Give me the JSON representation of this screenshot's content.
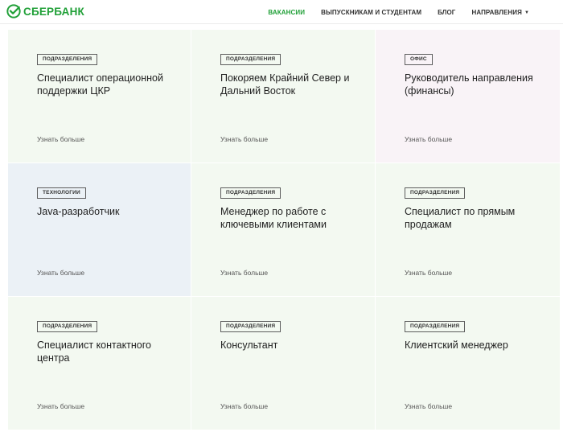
{
  "header": {
    "logo_text": "СБЕРБАНК",
    "nav": [
      {
        "label": "ВАКАНСИИ",
        "active": true
      },
      {
        "label": "ВЫПУСКНИКАМ И СТУДЕНТАМ",
        "active": false
      },
      {
        "label": "БЛОГ",
        "active": false
      },
      {
        "label": "НАПРАВЛЕНИЯ",
        "active": false,
        "dropdown": true
      }
    ]
  },
  "cards": [
    {
      "tag": "ПОДРАЗДЕЛЕНИЯ",
      "title": "Специалист операционной поддержки ЦКР",
      "more": "Узнать больше",
      "bg": "#f3f9f1"
    },
    {
      "tag": "ПОДРАЗДЕЛЕНИЯ",
      "title": "Покоряем Крайний Север и Дальний Восток",
      "more": "Узнать больше",
      "bg": "#f3f9f1"
    },
    {
      "tag": "ОФИС",
      "title": "Руководитель направления (финансы)",
      "more": "Узнать больше",
      "bg": "#f9f3f7"
    },
    {
      "tag": "ТЕХНОЛОГИИ",
      "title": "Java-разработчик",
      "more": "Узнать больше",
      "bg": "#ebf1f6"
    },
    {
      "tag": "ПОДРАЗДЕЛЕНИЯ",
      "title": "Менеджер по работе с ключевыми клиентами",
      "more": "Узнать больше",
      "bg": "#f3f9f1"
    },
    {
      "tag": "ПОДРАЗДЕЛЕНИЯ",
      "title": "Специалист по прямым продажам",
      "more": "Узнать больше",
      "bg": "#f3f9f1"
    },
    {
      "tag": "ПОДРАЗДЕЛЕНИЯ",
      "title": "Специалист контактного центра",
      "more": "Узнать больше",
      "bg": "#f3f9f1"
    },
    {
      "tag": "ПОДРАЗДЕЛЕНИЯ",
      "title": "Консультант",
      "more": "Узнать больше",
      "bg": "#f3f9f1"
    },
    {
      "tag": "ПОДРАЗДЕЛЕНИЯ",
      "title": "Клиентский менеджер",
      "more": "Узнать больше",
      "bg": "#f3f9f1"
    }
  ],
  "colors": {
    "brand": "#21a038",
    "text": "#222222"
  }
}
